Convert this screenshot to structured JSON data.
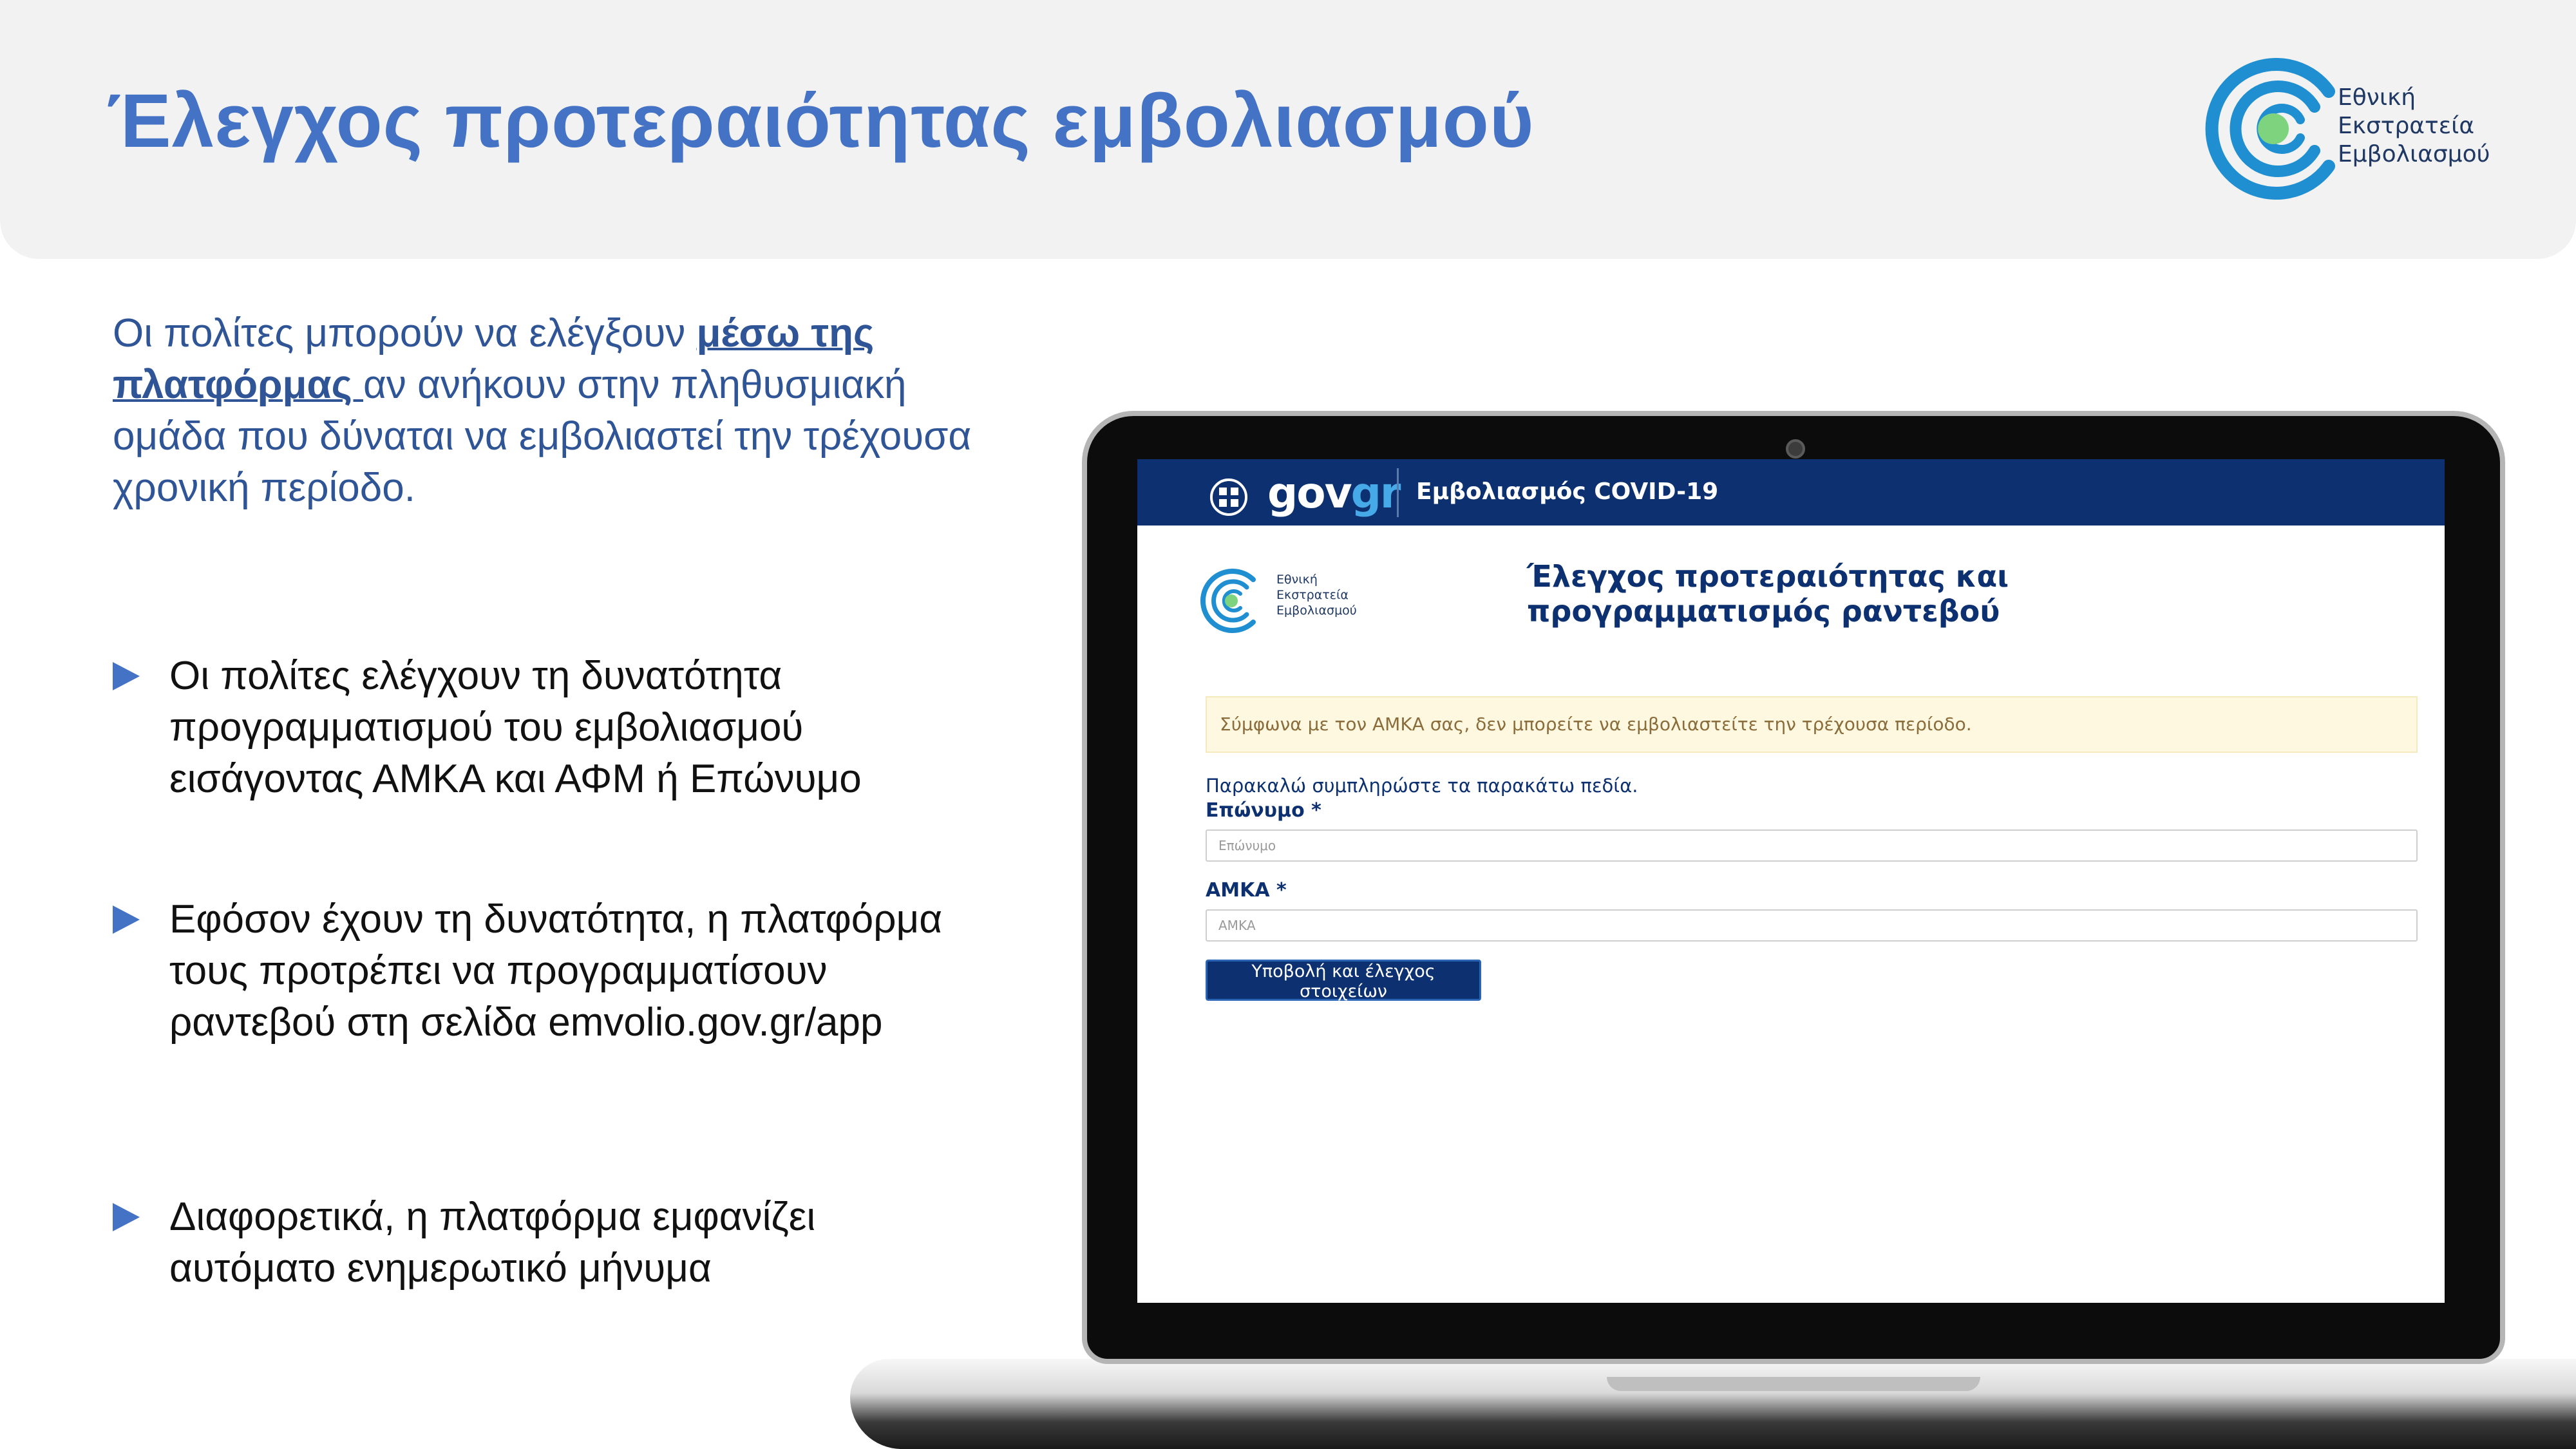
{
  "slide": {
    "title": "Έλεγχος προτεραιότητας εμβολιασμού",
    "brand": {
      "lines": [
        "Εθνική",
        "Εκστρατεία",
        "Εμβολιασμού"
      ],
      "icon": "vaccination-campaign-logo-icon"
    },
    "intro": {
      "before": "Οι πολίτες μπορούν να ελέγξουν ",
      "link": "μέσω της πλατφόρμας ",
      "after": "αν ανήκουν στην πληθυσμιακή ομάδα που δύναται να εμβολιαστεί την τρέχουσα χρονική περίοδο."
    },
    "bullets": [
      "Οι πολίτες ελέγχουν τη δυνατότητα προγραμματισμού του εμβολιασμού εισάγοντας ΑΜΚΑ και ΑΦΜ ή Επώνυμο",
      "Εφόσον έχουν τη δυνατότητα, η πλατφόρμα τους προτρέπει να προγραμματίσουν ραντεβού στη σελίδα emvolio.gov.gr/app",
      "Διαφορετικά, η πλατφόρμα εμφανίζει αυτόματο ενημερωτικό μήνυμα"
    ]
  },
  "screen": {
    "gov_logo": {
      "gov": "gov",
      "gr": "gr"
    },
    "gov_title": "Εμβολιασμός COVID-19",
    "inner_logo_lines": [
      "Εθνική",
      "Εκστρατεία",
      "Εμβολιασμού"
    ],
    "heading": "Έλεγχος προτεραιότητας και προγραμματισμός ραντεβού",
    "alert": "Σύμφωνα με τον ΑΜΚΑ σας, δεν μπορείτε να εμβολιαστείτε την τρέχουσα περίοδο.",
    "form_intro": "Παρακαλώ συμπληρώστε τα παρακάτω πεδία.",
    "surname": {
      "label": "Επώνυμο *",
      "placeholder": "Επώνυμο",
      "value": ""
    },
    "amka": {
      "label": "ΑΜΚΑ *",
      "placeholder": "ΑΜΚΑ",
      "value": ""
    },
    "submit_label": "Υποβολή και έλεγχος στοιχείων"
  },
  "colors": {
    "accent": "#4472c4",
    "intro_text": "#2f5597",
    "gov_navy": "#0d3170",
    "gov_light_blue": "#46a9e8",
    "logo_green": "#7ed37f",
    "logo_blue": "#1f8fd1",
    "alert_bg": "#fff8e1"
  }
}
